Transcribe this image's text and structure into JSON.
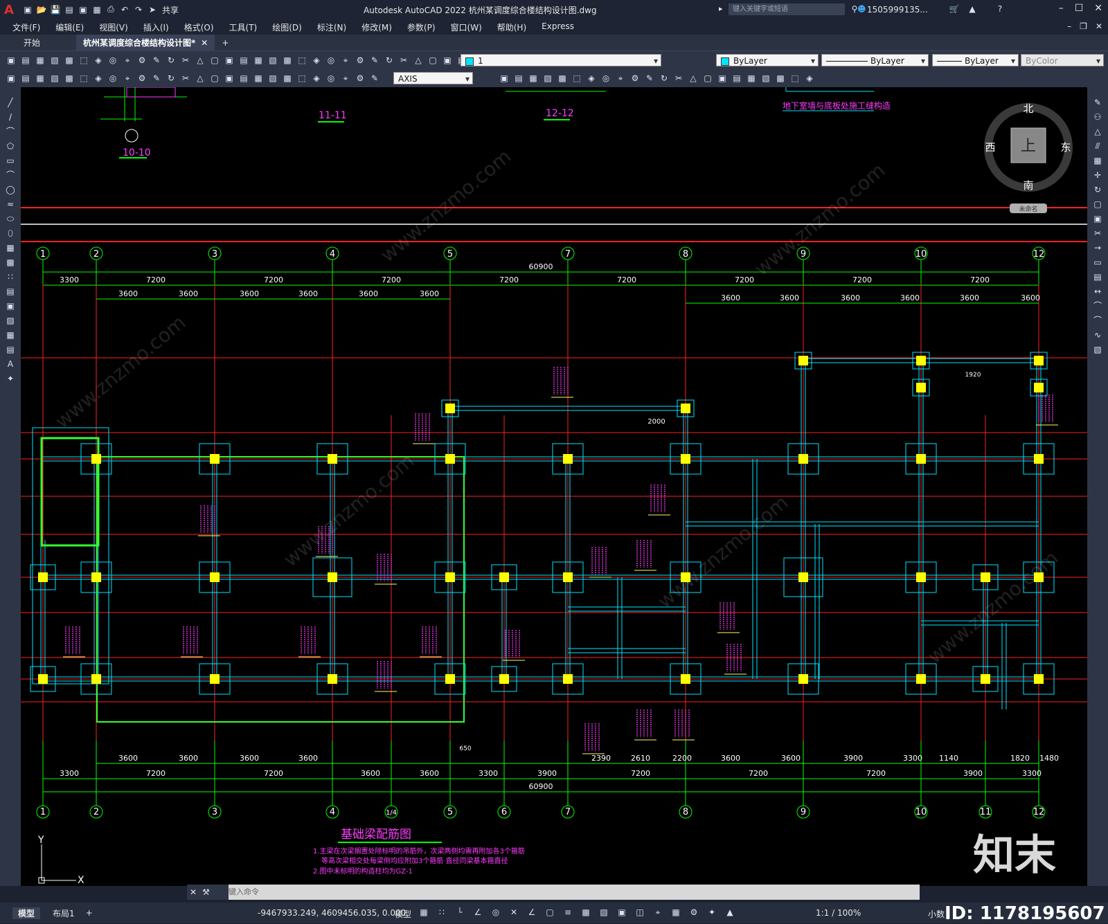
{
  "app": {
    "logo_letter": "A",
    "share_label": "共享",
    "title": "Autodesk AutoCAD 2022    杭州某调度综合楼结构设计图.dwg",
    "search_placeholder": "键入关键字或短语",
    "user": "1505999135...",
    "menus": [
      "文件(F)",
      "编辑(E)",
      "视图(V)",
      "插入(I)",
      "格式(O)",
      "工具(T)",
      "绘图(D)",
      "标注(N)",
      "修改(M)",
      "参数(P)",
      "窗口(W)",
      "帮助(H)",
      "Express"
    ]
  },
  "tabs": {
    "start": "开始",
    "drawing": "杭州某调度综合楼结构设计图*",
    "add": "+"
  },
  "toolbar": {
    "layer_value": "1",
    "color_value": "ByLayer",
    "linetype_value": "ByLayer",
    "lineweight_value": "ByLayer",
    "plotstyle_value": "ByColor",
    "textstyle_value": "AXIS"
  },
  "drawing": {
    "sections": [
      "11-11",
      "12-12",
      "10-10"
    ],
    "section_note": "地下室墙与底板处施工缝构造",
    "compass": {
      "north": "北",
      "south": "南",
      "east": "东",
      "west": "西",
      "center": "上",
      "ucs": "未命名"
    },
    "grid_top": [
      "1",
      "2",
      "3",
      "4",
      "5",
      "7",
      "8",
      "9",
      "10",
      "12"
    ],
    "grid_bottom": [
      "1",
      "2",
      "3",
      "4",
      "1/4",
      "5",
      "6",
      "7",
      "8",
      "9",
      "10",
      "11",
      "12"
    ],
    "total_dim": "60900",
    "top_row1": [
      "3300",
      "7200",
      "7200",
      "7200",
      "7200",
      "7200",
      "7200",
      "7200",
      "7200"
    ],
    "top_row2_left": [
      "3600",
      "3600",
      "3600",
      "3600",
      "3600",
      "3600"
    ],
    "top_row2_right": [
      "3600",
      "3600",
      "3600",
      "3600",
      "3600",
      "3600"
    ],
    "bottom_row1": [
      "3600",
      "3600",
      "3600",
      "3600",
      "2390",
      "2610",
      "2200",
      "3600",
      "3600",
      "3900",
      "3300",
      "1140",
      "1820",
      "1480"
    ],
    "bottom_row2": [
      "3300",
      "7200",
      "7200",
      "3600",
      "3600",
      "3300",
      "3900",
      "7200",
      "7200",
      "7200",
      "3900",
      "3300"
    ],
    "misc_dims": [
      "2000",
      "1920",
      "650"
    ],
    "plan_title": "基础梁配筋图",
    "notes": [
      "1.主梁在次梁搁置处除标明的吊筋外，次梁两侧均需再附加各3个箍筋",
      "等高次梁相交处每梁侧均应附加3个箍筋 直径同梁基本箍直径",
      "2.图中未标明的构造柱均为GZ-1"
    ],
    "ucs_x": "X",
    "ucs_y": "Y"
  },
  "command": {
    "placeholder": "键入命令"
  },
  "status": {
    "model_tab": "模型",
    "layout_tab": "布局1",
    "add": "+",
    "coords": "-9467933.249, 4609456.035, 0.000",
    "space": "模型",
    "scale": "1:1 / 100%",
    "units": "小数"
  },
  "watermark": {
    "brand": "知末",
    "id_text": "ID: 1178195607",
    "site": "www.znzmo.com"
  },
  "colors": {
    "canvas": "#000000",
    "dim": "#00ff00",
    "axis": "#ff2020",
    "beam": "#00e5ff",
    "column": "#ffff00",
    "label": "#ff3cff"
  }
}
